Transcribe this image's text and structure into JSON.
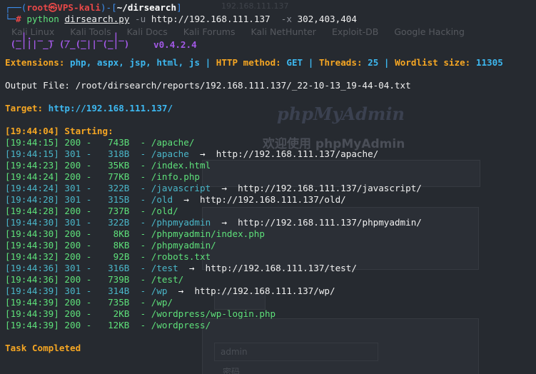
{
  "background": {
    "url_text": "192.168.111.137",
    "bookmarks": [
      "Kali Linux",
      "Kali Tools",
      "Kali Docs",
      "Kali Forums",
      "Kali NetHunter",
      "Exploit-DB",
      "Google Hacking"
    ],
    "logo": "phpMyAdmin",
    "welcome": "欢迎使用 phpMyAdmin",
    "input_value": "admin",
    "input_label": "密码"
  },
  "prompt": {
    "top_left": "┌──(",
    "user": "root㉿VPS-kali",
    "mid": ")-[",
    "path": "~/dirsearch",
    "end": "]",
    "second_prefix": "└─",
    "hash": "#",
    "cmd_python": "python",
    "cmd_script": "dirsearch.py",
    "cmd_flag_u": "-u",
    "cmd_url": "http://192.168.111.137",
    "cmd_flag_x": "-x",
    "cmd_codes": "302,403,404"
  },
  "banner": {
    "line1": "  _|. _ _  _  _  _ _|_    ",
    "line2": " (_||| _) (/_(_|| (_| )   ",
    "version": "v0.4.2.4"
  },
  "config": {
    "ext_label": "Extensions:",
    "ext_value": "php, aspx, jsp, html, js",
    "sep": "|",
    "method_label": "HTTP method:",
    "method_value": "GET",
    "threads_label": "Threads:",
    "threads_value": "25",
    "wordlist_label": "Wordlist size:",
    "wordlist_value": "11305"
  },
  "output_file": "Output File: /root/dirsearch/reports/192.168.111.137/_22-10-13_19-44-04.txt",
  "target": {
    "label": "Target:",
    "value": "http://192.168.111.137/"
  },
  "starting": {
    "time": "[19:44:04]",
    "label": "Starting:"
  },
  "results": [
    {
      "time": "[19:44:15]",
      "status": "200",
      "size": "743B",
      "path": "/apache/",
      "redirect": ""
    },
    {
      "time": "[19:44:15]",
      "status": "301",
      "size": "318B",
      "path": "/apache",
      "redirect": "http://192.168.111.137/apache/"
    },
    {
      "time": "[19:44:23]",
      "status": "200",
      "size": "35KB",
      "path": "/index.html",
      "redirect": ""
    },
    {
      "time": "[19:44:24]",
      "status": "200",
      "size": "77KB",
      "path": "/info.php",
      "redirect": ""
    },
    {
      "time": "[19:44:24]",
      "status": "301",
      "size": "322B",
      "path": "/javascript",
      "redirect": "http://192.168.111.137/javascript/"
    },
    {
      "time": "[19:44:28]",
      "status": "301",
      "size": "315B",
      "path": "/old",
      "redirect": "http://192.168.111.137/old/"
    },
    {
      "time": "[19:44:28]",
      "status": "200",
      "size": "737B",
      "path": "/old/",
      "redirect": ""
    },
    {
      "time": "[19:44:30]",
      "status": "301",
      "size": "322B",
      "path": "/phpmyadmin",
      "redirect": "http://192.168.111.137/phpmyadmin/"
    },
    {
      "time": "[19:44:30]",
      "status": "200",
      "size": "8KB",
      "path": "/phpmyadmin/index.php",
      "redirect": ""
    },
    {
      "time": "[19:44:30]",
      "status": "200",
      "size": "8KB",
      "path": "/phpmyadmin/",
      "redirect": ""
    },
    {
      "time": "[19:44:32]",
      "status": "200",
      "size": "92B",
      "path": "/robots.txt",
      "redirect": ""
    },
    {
      "time": "[19:44:36]",
      "status": "301",
      "size": "316B",
      "path": "/test",
      "redirect": "http://192.168.111.137/test/"
    },
    {
      "time": "[19:44:36]",
      "status": "200",
      "size": "739B",
      "path": "/test/",
      "redirect": ""
    },
    {
      "time": "[19:44:39]",
      "status": "301",
      "size": "314B",
      "path": "/wp",
      "redirect": "http://192.168.111.137/wp/"
    },
    {
      "time": "[19:44:39]",
      "status": "200",
      "size": "735B",
      "path": "/wp/",
      "redirect": ""
    },
    {
      "time": "[19:44:39]",
      "status": "200",
      "size": "2KB",
      "path": "/wordpress/wp-login.php",
      "redirect": ""
    },
    {
      "time": "[19:44:39]",
      "status": "200",
      "size": "12KB",
      "path": "/wordpress/",
      "redirect": ""
    }
  ],
  "arrow": "→",
  "completed": "Task Completed",
  "colors": {
    "background": "#262a30",
    "prompt_blue": "#3d8ff0",
    "prompt_red": "#e84848",
    "orange": "#f5a623",
    "cyan": "#3db8f0",
    "purple": "#a259e6",
    "ok_green": "#5ee07a",
    "redirect_cyan": "#4ab6c8"
  }
}
